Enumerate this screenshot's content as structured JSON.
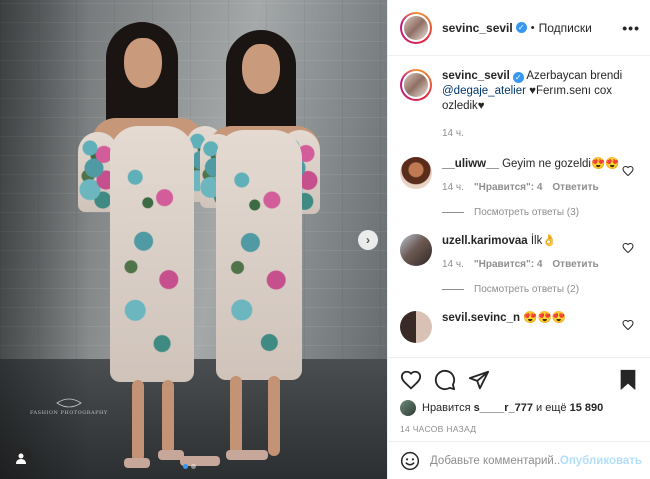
{
  "header": {
    "username": "sevinc_sevil",
    "separator": "•",
    "follow_label": "Подписки",
    "more_label": "•••"
  },
  "caption": {
    "username": "sevinc_sevil",
    "text_before": "Azerbaycan brendi",
    "mention": "@degaje_atelier",
    "text_after": "♥Ferım.senı cox ozledik♥",
    "time": "14 ч."
  },
  "comments": [
    {
      "username": "__uliww__",
      "text": "Geyim ne gozeldi😍😍",
      "time": "14 ч.",
      "likes": "\"Нравится\": 4",
      "reply_label": "Ответить",
      "view_replies": "Посмотреть ответы (3)"
    },
    {
      "username": "uzell.karimovaa",
      "text": "İlk👌",
      "time": "14 ч.",
      "likes": "\"Нравится\": 4",
      "reply_label": "Ответить",
      "view_replies": "Посмотреть ответы (2)"
    },
    {
      "username": "sevil.sevinc_n",
      "text": "😍😍😍"
    }
  ],
  "likes_line": {
    "prefix": "Нравится",
    "user": "s____r_777",
    "middle": "и ещё",
    "count": "15 890"
  },
  "post_time": "14 ЧАСОВ НАЗАД",
  "comment_input": {
    "placeholder": "Добавьте комментарий...",
    "publish_label": "Опубликовать"
  },
  "photo": {
    "watermark": "FASHION PHOTOGRAPHY",
    "carousel": {
      "total": 2,
      "active": 1
    }
  }
}
